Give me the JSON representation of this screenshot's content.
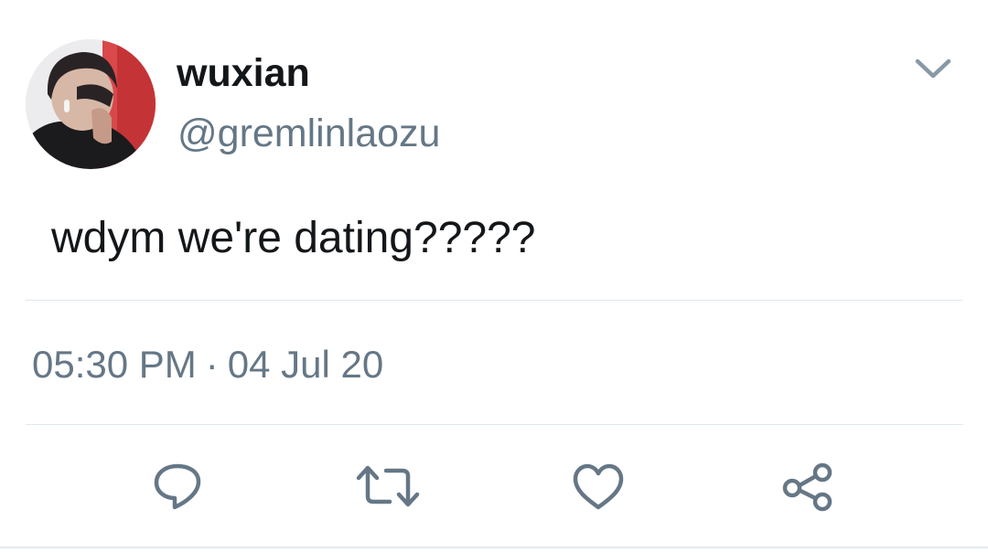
{
  "user": {
    "display_name": "wuxian",
    "handle": "@gremlinlaozu",
    "avatar_icon": "profile-photo"
  },
  "tweet": {
    "text": "wdym we're dating?????",
    "time": "05:30 PM",
    "separator": "·",
    "date": "04 Jul 20"
  },
  "actions": {
    "reply_icon": "speech-bubble-icon",
    "retweet_icon": "retweet-arrows-icon",
    "like_icon": "heart-icon",
    "share_icon": "share-icon"
  },
  "colors": {
    "text_primary": "#14171a",
    "text_secondary": "#657786",
    "icon": "#657786",
    "divider": "#e1e8ed"
  }
}
